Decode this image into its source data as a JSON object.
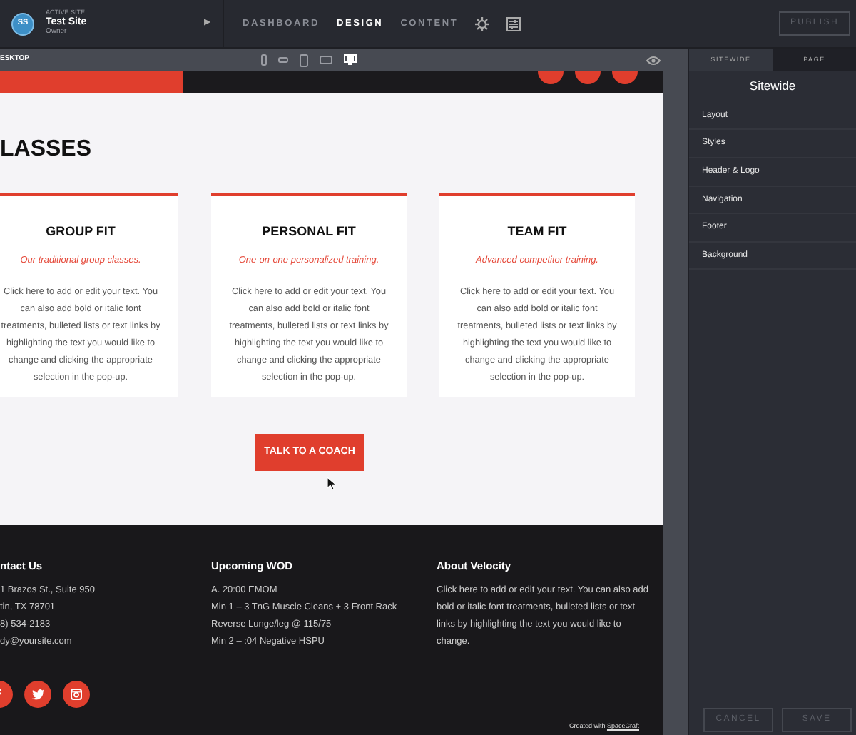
{
  "topbar": {
    "avatar": "SS",
    "site_label": "ACTIVE SITE",
    "site_name": "Test Site",
    "role": "Owner",
    "arrow": "▶",
    "nav": [
      {
        "label": "DASHBOARD",
        "selected": false
      },
      {
        "label": "DESIGN",
        "selected": true
      },
      {
        "label": "CONTENT",
        "selected": false
      }
    ],
    "publish": "PUBLISH"
  },
  "toolbar": {
    "view_label": "ESKTOP",
    "devices": [
      {
        "kind": "phone",
        "selected": false
      },
      {
        "kind": "phone-landscape",
        "selected": false
      },
      {
        "kind": "tablet",
        "selected": false
      },
      {
        "kind": "tablet-landscape",
        "selected": false
      },
      {
        "kind": "desktop",
        "selected": true
      }
    ]
  },
  "canvas": {
    "heading": "LASSES",
    "cards": [
      {
        "title": "GROUP FIT",
        "tagline": "Our traditional group classes.",
        "body": "Click here to add or edit your text. You can also add bold or italic font treatments, bulleted lists or text links by highlighting the text you would like to change and clicking the appropriate selection in the pop-up."
      },
      {
        "title": "PERSONAL FIT",
        "tagline": "One-on-one personalized training.",
        "body": "Click here to add or edit your text. You can also add bold or italic font treatments, bulleted lists or text links by highlighting the text you would like to change and clicking the appropriate selection in the pop-up."
      },
      {
        "title": "TEAM FIT",
        "tagline": "Advanced competitor training.",
        "body": "Click here to add or edit your text. You can also add bold or italic font treatments, bulleted lists or text links by highlighting the text you would like to change and clicking the appropriate selection in the pop-up."
      }
    ],
    "cta": "TALK TO A COACH",
    "footer": {
      "columns": [
        {
          "title": "ntact Us",
          "lines": [
            "1 Brazos St., Suite 950",
            "tin, TX 78701",
            "8) 534-2183",
            "dy@yoursite.com"
          ]
        },
        {
          "title": "Upcoming WOD",
          "lines": [
            "A. 20:00 EMOM",
            "Min 1 – 3 TnG Muscle Cleans + 3 Front Rack",
            "Reverse Lunge/leg @ 115/75",
            "Min 2 – :04 Negative HSPU"
          ]
        },
        {
          "title": "About Velocity",
          "lines": [
            "Click here to add or edit your text. You can also add bold or italic font treatments, bulleted lists or text links by highlighting the text you would like to change."
          ]
        }
      ],
      "social": [
        {
          "kind": "facebook"
        },
        {
          "kind": "twitter"
        },
        {
          "kind": "instagram"
        }
      ],
      "credit_prefix": "Created with",
      "credit_link": "SpaceCraft"
    }
  },
  "panel": {
    "tabs": [
      {
        "label": "SITEWIDE",
        "selected": true
      },
      {
        "label": "PAGE",
        "selected": false
      }
    ],
    "title": "Sitewide",
    "items": [
      "Layout",
      "Styles",
      "Header & Logo",
      "Navigation",
      "Footer",
      "Background"
    ],
    "buttons": [
      "CANCEL",
      "SAVE"
    ]
  }
}
